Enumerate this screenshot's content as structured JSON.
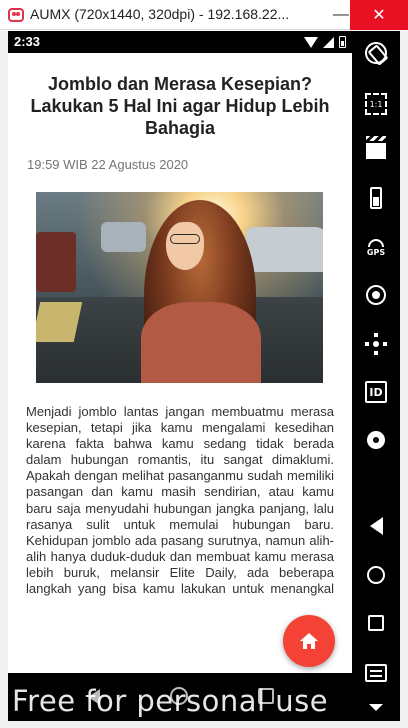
{
  "window": {
    "title": "AUMX (720x1440, 320dpi) - 192.168.22...",
    "minimize_label": "—",
    "close_label": "✕"
  },
  "status_bar": {
    "time": "2:33"
  },
  "article": {
    "title": "Jomblo dan Merasa Kesepian? Lakukan 5 Hal Ini agar Hidup Lebih Bahagia",
    "date": "19:59 WIB 22 Agustus 2020",
    "body": "Menjadi jomblo lantas jangan membuatmu merasa kesepian, tetapi jika kamu mengalami kesedihan karena fakta bahwa kamu sedang tidak berada dalam hubungan romantis, itu sangat dimaklumi. Apakah dengan melihat pasanganmu sudah memiliki pasangan dan kamu masih sendirian, atau kamu baru saja menyudahi hubungan jangka panjang, lalu rasanya sulit untuk memulai hubungan baru. Kehidupan jomblo ada pasang surutnya, namun alih-alih hanya duduk-duduk dan membuat kamu merasa lebih buruk, melansir Elite Daily, ada beberapa langkah yang bisa kamu lakukan untuk menangkal rasa kesepian"
  },
  "fab": {
    "icon": "home-icon",
    "color": "#f44336"
  },
  "side_toolbar": {
    "scale_label": "1:1",
    "gps_label": "GPS",
    "id_label": "ID"
  },
  "watermark": {
    "text": "Free for personal use"
  }
}
